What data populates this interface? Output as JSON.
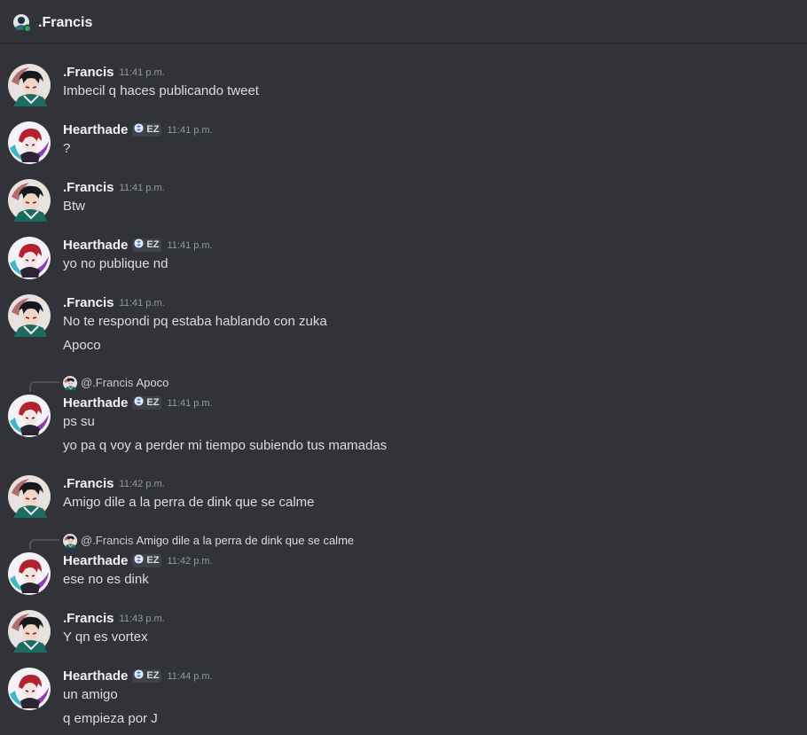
{
  "header": {
    "title": ".Francis"
  },
  "users": {
    "francis": {
      "name": ".Francis"
    },
    "hearthade": {
      "name": "Hearthade",
      "badge": "EZ"
    }
  },
  "messages": [
    {
      "author": ".Francis",
      "time": "11:41 p.m.",
      "lines": [
        "Imbecil q haces publicando tweet"
      ]
    },
    {
      "author": "Hearthade",
      "badge": "EZ",
      "time": "11:41 p.m.",
      "lines": [
        "?"
      ]
    },
    {
      "author": ".Francis",
      "time": "11:41 p.m.",
      "lines": [
        "Btw"
      ]
    },
    {
      "author": "Hearthade",
      "badge": "EZ",
      "time": "11:41 p.m.",
      "lines": [
        "yo no publique nd"
      ]
    },
    {
      "author": ".Francis",
      "time": "11:41 p.m.",
      "lines": [
        "No te respondi pq estaba hablando con zuka",
        "Apoco"
      ]
    },
    {
      "author": "Hearthade",
      "badge": "EZ",
      "time": "11:41 p.m.",
      "reply": {
        "name": "@.Francis",
        "preview": "Apoco"
      },
      "lines": [
        "ps su",
        "yo pa q voy a perder mi tiempo subiendo tus mamadas"
      ]
    },
    {
      "author": ".Francis",
      "time": "11:42 p.m.",
      "lines": [
        "Amigo dile a la perra de dink que se calme"
      ]
    },
    {
      "author": "Hearthade",
      "badge": "EZ",
      "time": "11:42 p.m.",
      "reply": {
        "name": "@.Francis",
        "preview": "Amigo dile a la perra de dink que se calme"
      },
      "lines": [
        "ese no es dink"
      ]
    },
    {
      "author": ".Francis",
      "time": "11:43 p.m.",
      "lines": [
        "Y qn es vortex"
      ]
    },
    {
      "author": "Hearthade",
      "badge": "EZ",
      "time": "11:44 p.m.",
      "lines": [
        "un amigo",
        "q empieza por J"
      ]
    }
  ],
  "colors": {
    "background": "#313338",
    "name": "#f2f3f5",
    "text": "#dbdee1",
    "timestamp": "#949ba4",
    "online": "#23a55a"
  }
}
